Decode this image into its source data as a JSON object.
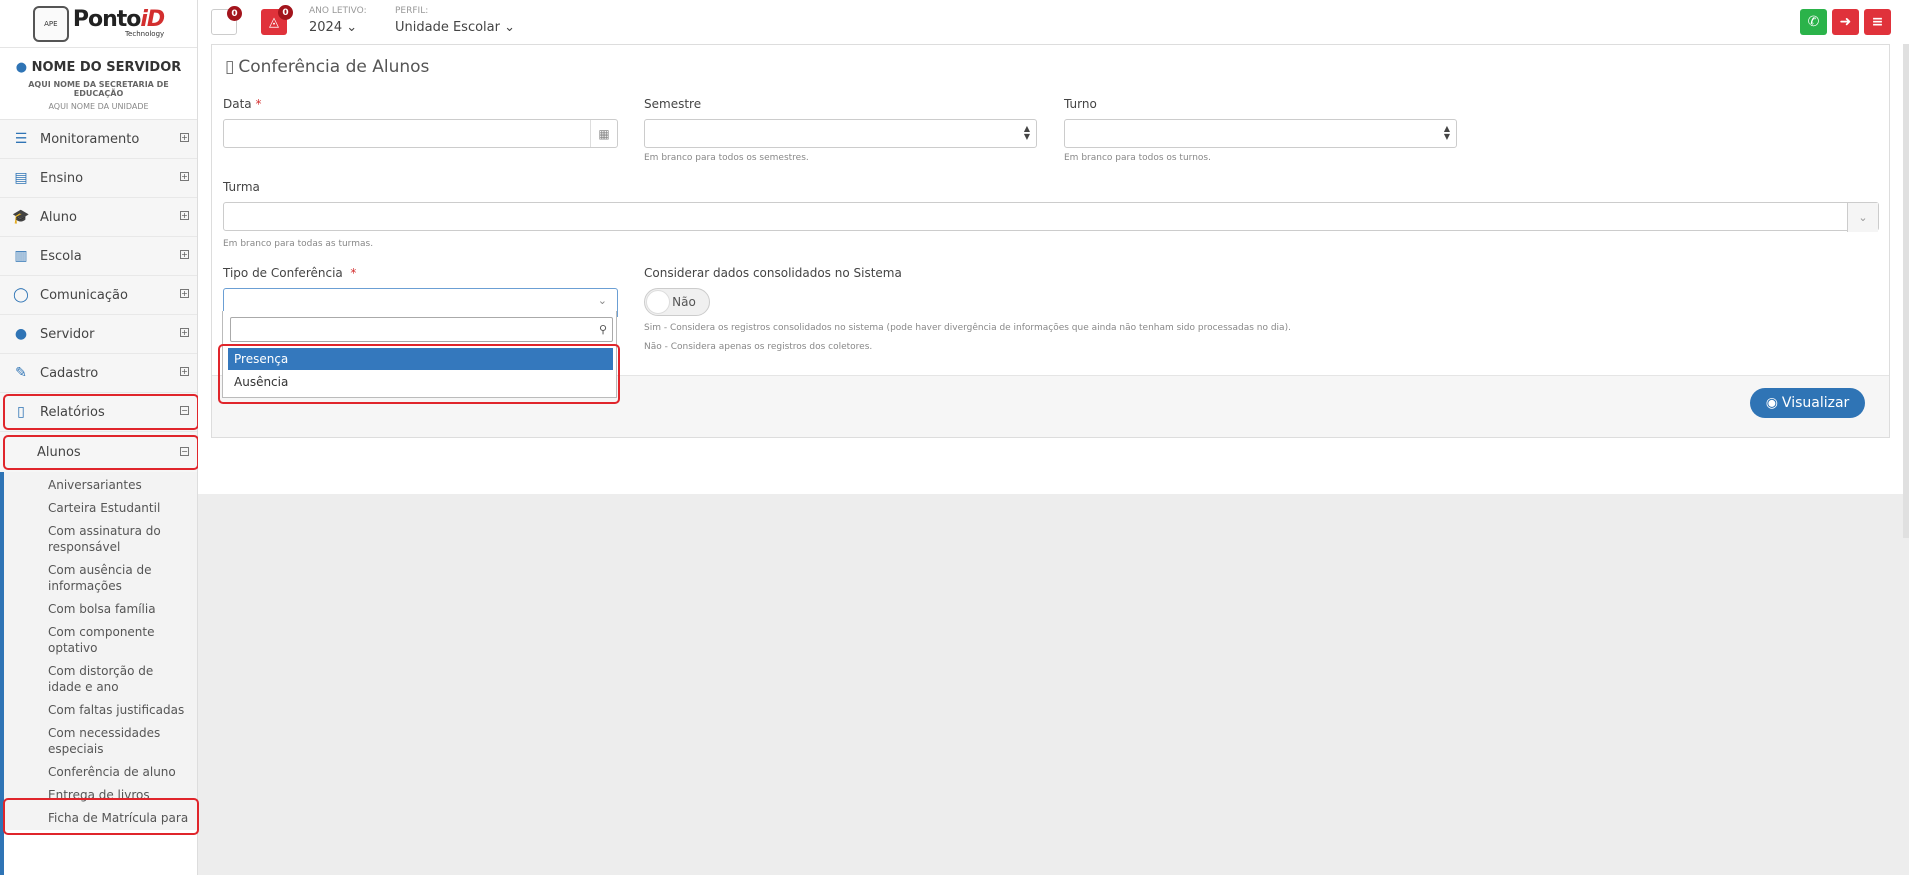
{
  "logo": {
    "small": "APE",
    "brand_main": "Ponto",
    "brand_accent": "iD",
    "sub": "Technology"
  },
  "user": {
    "name": "NOME DO SERVIDOR",
    "secretaria": "AQUI NOME DA SECRETARIA DE EDUCAÇÃO",
    "unidade": "AQUI NOME DA UNIDADE"
  },
  "sidebar": {
    "items": [
      {
        "label": "Monitoramento",
        "icon": "sliders-icon",
        "glyph": "☰"
      },
      {
        "label": "Ensino",
        "icon": "book-icon",
        "glyph": "▤"
      },
      {
        "label": "Aluno",
        "icon": "graduation-cap-icon",
        "glyph": "🎓"
      },
      {
        "label": "Escola",
        "icon": "bank-icon",
        "glyph": "▥"
      },
      {
        "label": "Comunicação",
        "icon": "chat-icon",
        "glyph": "◯"
      },
      {
        "label": "Servidor",
        "icon": "user-icon",
        "glyph": "●"
      },
      {
        "label": "Cadastro",
        "icon": "edit-icon",
        "glyph": "✎"
      },
      {
        "label": "Relatórios",
        "icon": "file-text-icon",
        "glyph": "▯"
      }
    ],
    "plus": "+",
    "minus": "−",
    "alunos_label": "Alunos",
    "subitems": [
      "Aniversariantes",
      "Carteira Estudantil",
      "Com assinatura do responsável",
      "Com ausência de informações",
      "Com bolsa família",
      "Com componente optativo",
      "Com distorção de idade e ano",
      "Com faltas justificadas",
      "Com necessidades especiais",
      "Conferência de aluno",
      "Entrega de livros",
      "Ficha de Matrícula para"
    ]
  },
  "topbar": {
    "badge1": "0",
    "badge2": "0",
    "ano_label": "ANO LETIVO:",
    "ano_value": "2024 ⌄",
    "perfil_label": "PERFIL:",
    "perfil_value": "Unidade Escolar ⌄",
    "colors": {
      "whatsapp": "#2bb34a",
      "logout": "#e0323b",
      "menu": "#e0323b",
      "bell": "#e0323b"
    }
  },
  "form": {
    "title": "Conferência de Alunos",
    "data_label": "Data",
    "required_mark": "*",
    "semestre_label": "Semestre",
    "semestre_help": "Em branco para todos os semestres.",
    "turno_label": "Turno",
    "turno_help": "Em branco para todos os turnos.",
    "turma_label": "Turma",
    "turma_help": "Em branco para todas as turmas.",
    "tipo_label": "Tipo de Conferência",
    "consolidados_label": "Considerar dados consolidados no Sistema",
    "toggle_value": "Não",
    "help_sim": "Sim - Considera os registros consolidados no sistema (pode haver divergência de informações que ainda não tenham sido processadas no dia).",
    "help_nao": "Não - Considera apenas os registros dos coletores.",
    "visualizar_label": "Visualizar"
  },
  "dropdown": {
    "search_value": "",
    "options": [
      "Presença",
      "Ausência"
    ],
    "selected": "Presença"
  }
}
